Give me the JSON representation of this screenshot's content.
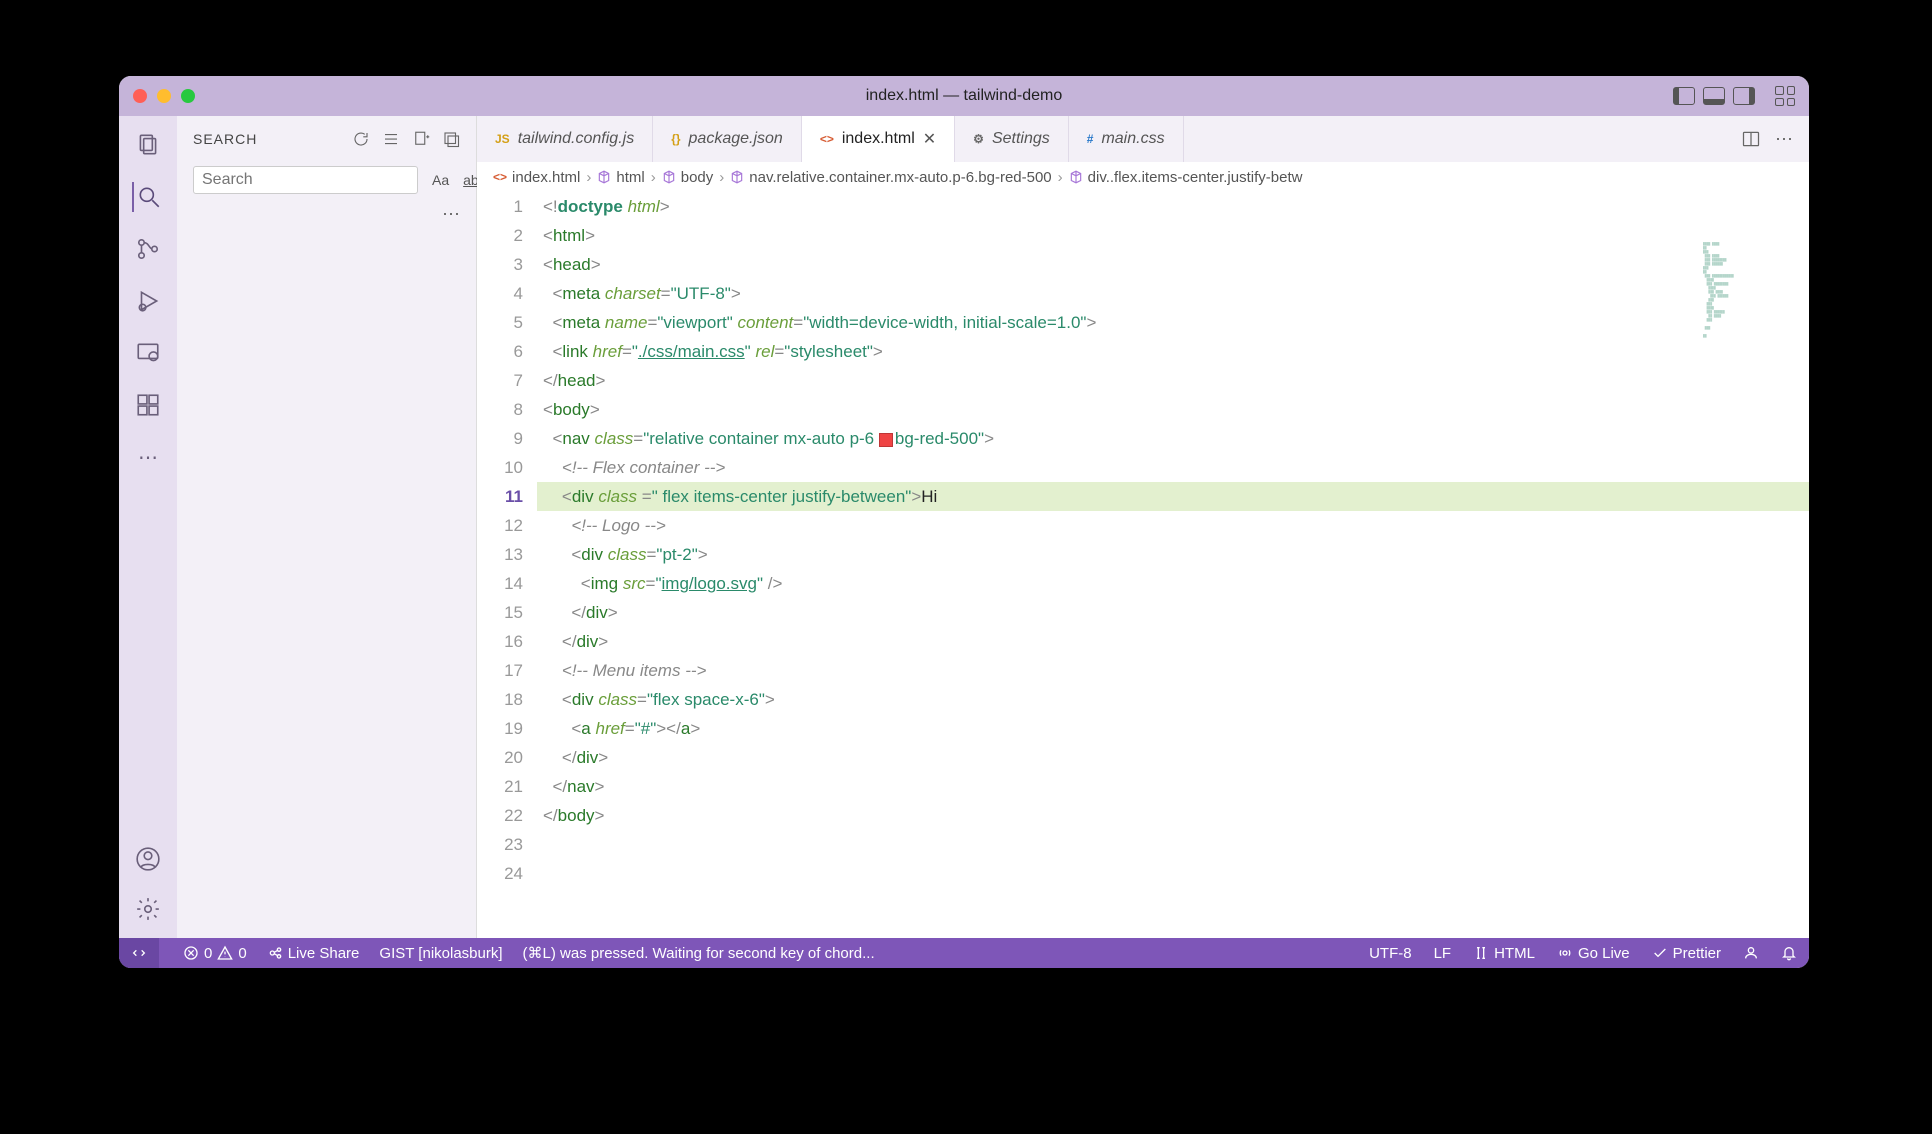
{
  "title": "index.html — tailwind-demo",
  "sidebar": {
    "title": "SEARCH",
    "placeholder": "Search",
    "opts": {
      "case": "Aa",
      "word": "ab",
      "regex": ".*"
    }
  },
  "tabs": [
    {
      "icon": "JS",
      "iconClass": "js",
      "name": "tailwind.config.js",
      "italic": true
    },
    {
      "icon": "{}",
      "iconClass": "json",
      "name": "package.json",
      "italic": true
    },
    {
      "icon": "<>",
      "iconClass": "htmli",
      "name": "index.html",
      "active": true,
      "close": true
    },
    {
      "icon": "⚙",
      "iconClass": "gear",
      "name": "Settings",
      "italic": true
    },
    {
      "icon": "#",
      "iconClass": "css",
      "name": "main.css",
      "italic": true
    }
  ],
  "breadcrumb": [
    "index.html",
    "html",
    "body",
    "nav.relative.container.mx-auto.p-6.bg-red-500",
    "div..flex.items-center.justify-betw"
  ],
  "gutter": [
    "1",
    "2",
    "3",
    "4",
    "5",
    "6",
    "7",
    "8",
    "9",
    "10",
    "11",
    "12",
    "13",
    "14",
    "15",
    "16",
    "17",
    "18",
    "19",
    "20",
    "21",
    "22",
    "23",
    "24"
  ],
  "activeLine": 11,
  "code": {
    "l1": {
      "doctype": "doctype",
      "html": "html"
    },
    "l2": "html",
    "l3": "head",
    "l4": {
      "tag": "meta",
      "a1": "charset",
      "v1": "UTF-8"
    },
    "l5": {
      "tag": "meta",
      "a1": "name",
      "v1": "viewport",
      "a2": "content",
      "v2": "width=device-width, initial-scale=1.0"
    },
    "l6": {
      "tag": "link",
      "a1": "href",
      "v1": "./css/main.css",
      "a2": "rel",
      "v2": "stylesheet"
    },
    "l7": "head",
    "l8": "body",
    "l9": {
      "tag": "nav",
      "a": "class",
      "v1": "relative container mx-auto p-6 ",
      "v2": "bg-red-500"
    },
    "l10": " Flex container ",
    "l11": {
      "tag": "div",
      "a": "class",
      "v": " flex items-center justify-between",
      "txt": "Hi"
    },
    "l12": " Logo ",
    "l13": {
      "tag": "div",
      "a": "class",
      "v": "pt-2"
    },
    "l14": {
      "tag": "img",
      "a": "src",
      "v": "img/logo.svg"
    },
    "l15": "div",
    "l16": "div",
    "l17": " Menu items ",
    "l18": {
      "tag": "div",
      "a": "class",
      "v": "flex space-x-6"
    },
    "l19": {
      "tag": "a",
      "a": "href",
      "v": "#"
    },
    "l20": "div",
    "l22": "nav",
    "l24": "body"
  },
  "status": {
    "errors": "0",
    "warnings": "0",
    "liveshare": "Live Share",
    "gist": "GIST [nikolasburk]",
    "msg": "(⌘L) was pressed. Waiting for second key of chord...",
    "encoding": "UTF-8",
    "eol": "LF",
    "lang": "HTML",
    "golive": "Go Live",
    "prettier": "Prettier"
  }
}
